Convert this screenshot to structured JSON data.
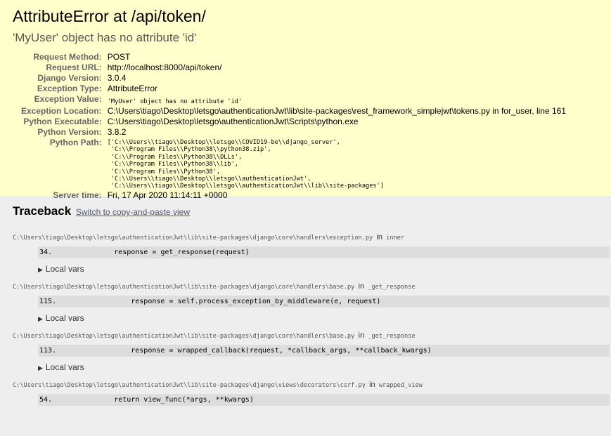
{
  "summary": {
    "title": "AttributeError at /api/token/",
    "subtitle": "'MyUser' object has no attribute 'id'",
    "fields": {
      "request_method": {
        "label": "Request Method:",
        "value": "POST"
      },
      "request_url": {
        "label": "Request URL:",
        "value": "http://localhost:8000/api/token/"
      },
      "django_version": {
        "label": "Django Version:",
        "value": "3.0.4"
      },
      "exception_type": {
        "label": "Exception Type:",
        "value": "AttributeError"
      },
      "exception_value": {
        "label": "Exception Value:",
        "value": "'MyUser' object has no attribute 'id'"
      },
      "exception_location": {
        "label": "Exception Location:",
        "value": "C:\\Users\\tiago\\Desktop\\letsgo\\authenticationJwt\\lib\\site-packages\\rest_framework_simplejwt\\tokens.py in for_user, line 161"
      },
      "python_executable": {
        "label": "Python Executable:",
        "value": "C:\\Users\\tiago\\Desktop\\letsgo\\authenticationJwt\\Scripts\\python.exe"
      },
      "python_version": {
        "label": "Python Version:",
        "value": "3.8.2"
      },
      "python_path": {
        "label": "Python Path:",
        "lines": [
          "['C:\\\\Users\\\\tiago\\\\Desktop\\\\letsgo\\\\COVID19-be\\\\django_server',",
          " 'C:\\\\Program Files\\\\Python38\\\\python38.zip',",
          " 'C:\\\\Program Files\\\\Python38\\\\DLLs',",
          " 'C:\\\\Program Files\\\\Python38\\\\lib',",
          " 'C:\\\\Program Files\\\\Python38',",
          " 'C:\\\\Users\\\\tiago\\\\Desktop\\\\letsgo\\\\authenticationJwt',",
          " 'C:\\\\Users\\\\tiago\\\\Desktop\\\\letsgo\\\\authenticationJwt\\\\lib\\\\site-packages']"
        ]
      },
      "server_time": {
        "label": "Server time:",
        "value": "Fri, 17 Apr 2020 11:14:11 +0000"
      }
    }
  },
  "traceback": {
    "heading": "Traceback",
    "switch_link": "Switch to copy-and-paste view",
    "in_word": "in",
    "local_vars_label": "Local vars",
    "frames": [
      {
        "file": "C:\\Users\\tiago\\Desktop\\letsgo\\authenticationJwt\\lib\\site-packages\\django\\core\\handlers\\exception.py",
        "func": "inner",
        "lineno": "34.",
        "code": "        response = get_response(request)"
      },
      {
        "file": "C:\\Users\\tiago\\Desktop\\letsgo\\authenticationJwt\\lib\\site-packages\\django\\core\\handlers\\base.py",
        "func": "_get_response",
        "lineno": "115.",
        "code": "            response = self.process_exception_by_middleware(e, request)"
      },
      {
        "file": "C:\\Users\\tiago\\Desktop\\letsgo\\authenticationJwt\\lib\\site-packages\\django\\core\\handlers\\base.py",
        "func": "_get_response",
        "lineno": "113.",
        "code": "            response = wrapped_callback(request, *callback_args, **callback_kwargs)"
      },
      {
        "file": "C:\\Users\\tiago\\Desktop\\letsgo\\authenticationJwt\\lib\\site-packages\\django\\views\\decorators\\csrf.py",
        "func": "wrapped_view",
        "lineno": "54.",
        "code": "        return view_func(*args, **kwargs)"
      }
    ]
  }
}
